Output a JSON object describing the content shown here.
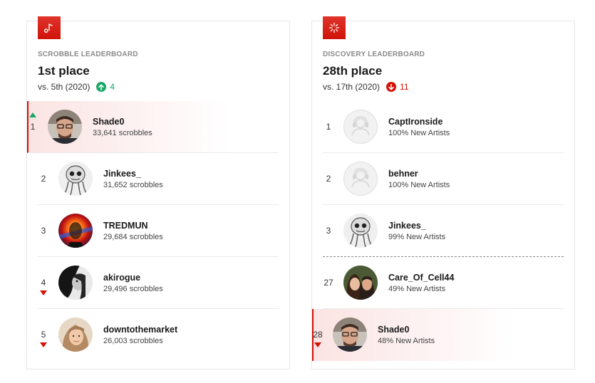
{
  "scrobble": {
    "icon": "music-note-icon",
    "overline": "SCROBBLE LEADERBOARD",
    "place": "1st place",
    "vs_text": "vs. 5th (2020)",
    "change": "4",
    "change_direction": "up",
    "rows": [
      {
        "rank": "1",
        "name": "Shade0",
        "meta": "33,641 scrobbles",
        "trend": "up",
        "highlight": true,
        "avatar": "avatar-photo-man-glasses"
      },
      {
        "rank": "2",
        "name": "Jinkees_",
        "meta": "31,652 scrobbles",
        "trend": "",
        "highlight": false,
        "avatar": "avatar-sketch"
      },
      {
        "rank": "3",
        "name": "TREDMUN",
        "meta": "29,684 scrobbles",
        "trend": "",
        "highlight": false,
        "avatar": "avatar-colorful"
      },
      {
        "rank": "4",
        "name": "akirogue",
        "meta": "29,496 scrobbles",
        "trend": "down",
        "highlight": false,
        "avatar": "avatar-bw-portrait"
      },
      {
        "rank": "5",
        "name": "downtothemarket",
        "meta": "26,003 scrobbles",
        "trend": "down",
        "highlight": false,
        "avatar": "avatar-woman"
      }
    ]
  },
  "discovery": {
    "icon": "sparkle-icon",
    "overline": "DISCOVERY LEADERBOARD",
    "place": "28th place",
    "vs_text": "vs. 17th (2020)",
    "change": "11",
    "change_direction": "down",
    "rows": [
      {
        "rank": "1",
        "name": "CaptIronside",
        "meta": "100% New Artists",
        "trend": "",
        "highlight": false,
        "avatar": "default-avatar-icon"
      },
      {
        "rank": "2",
        "name": "behner",
        "meta": "100% New Artists",
        "trend": "",
        "highlight": false,
        "avatar": "default-avatar-icon"
      },
      {
        "rank": "3",
        "name": "Jinkees_",
        "meta": "99% New Artists",
        "trend": "",
        "highlight": false,
        "avatar": "avatar-sketch",
        "dashed": true
      },
      {
        "rank": "27",
        "name": "Care_Of_Cell44",
        "meta": "49% New Artists",
        "trend": "",
        "highlight": false,
        "avatar": "avatar-couple"
      },
      {
        "rank": "28",
        "name": "Shade0",
        "meta": "48% New Artists",
        "trend": "down",
        "highlight": true,
        "avatar": "avatar-photo-man-glasses"
      }
    ]
  },
  "colors": {
    "accent": "#d51007",
    "up": "#19a866",
    "down": "#d51007"
  }
}
